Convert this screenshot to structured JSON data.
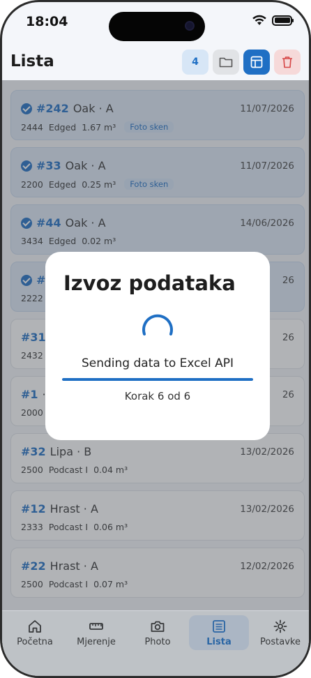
{
  "status": {
    "time": "18:04"
  },
  "header": {
    "title": "Lista",
    "count": "4"
  },
  "cards": [
    {
      "id": "#242",
      "species": "Oak · A",
      "date": "11/07/2026",
      "code": "2444",
      "type": "Edged",
      "volume": "1.67 m³",
      "badge": "Foto sken",
      "selected": true
    },
    {
      "id": "#33",
      "species": "Oak · A",
      "date": "11/07/2026",
      "code": "2200",
      "type": "Edged",
      "volume": "0.25 m³",
      "badge": "Foto sken",
      "selected": true
    },
    {
      "id": "#44",
      "species": "Oak · A",
      "date": "14/06/2026",
      "code": "3434",
      "type": "Edged",
      "volume": "0.02 m³",
      "badge": "",
      "selected": true
    },
    {
      "id": "#",
      "species": "",
      "date": "26",
      "code": "2222",
      "type": "",
      "volume": "",
      "badge": "",
      "selected": true
    },
    {
      "id": "#31",
      "species": "",
      "date": "26",
      "code": "2432",
      "type": "",
      "volume": "",
      "badge": "",
      "selected": false
    },
    {
      "id": "#1",
      "species": "·",
      "date": "26",
      "code": "2000",
      "type": "",
      "volume": "",
      "badge": "",
      "selected": false
    },
    {
      "id": "#32",
      "species": "Lipa · B",
      "date": "13/02/2026",
      "code": "2500",
      "type": "Podcast I",
      "volume": "0.04 m³",
      "badge": "",
      "selected": false
    },
    {
      "id": "#12",
      "species": "Hrast · A",
      "date": "13/02/2026",
      "code": "2333",
      "type": "Podcast I",
      "volume": "0.06 m³",
      "badge": "",
      "selected": false
    },
    {
      "id": "#22",
      "species": "Hrast · A",
      "date": "12/02/2026",
      "code": "2500",
      "type": "Podcast I",
      "volume": "0.07 m³",
      "badge": "",
      "selected": false
    }
  ],
  "modal": {
    "title": "Izvoz podataka",
    "message": "Sending data to Excel API",
    "step": "Korak 6 od 6",
    "progress": 1.0
  },
  "nav": [
    {
      "label": "Početna",
      "icon": "home-icon",
      "active": false
    },
    {
      "label": "Mjerenje",
      "icon": "ruler-icon",
      "active": false
    },
    {
      "label": "Photo",
      "icon": "camera-icon",
      "active": false
    },
    {
      "label": "Lista",
      "icon": "list-icon",
      "active": true
    },
    {
      "label": "Postavke",
      "icon": "gear-icon",
      "active": false
    }
  ],
  "colors": {
    "accent": "#1f6fc4",
    "danger": "#d64545"
  }
}
